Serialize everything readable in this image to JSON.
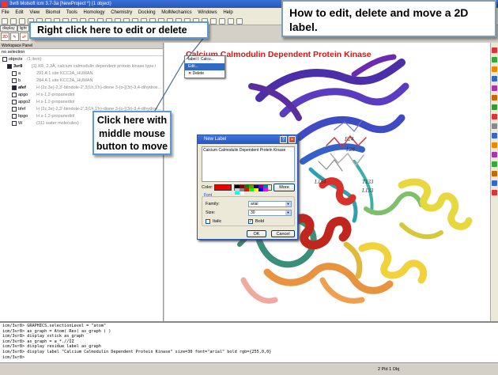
{
  "window": {
    "title": "3vr8 Molsoft icm 3.7-3a  [NewProject *] (1 object)"
  },
  "menu": {
    "items": [
      "File",
      "Edit",
      "View",
      "Biomol",
      "Tools",
      "Homology",
      "Chemistry",
      "Docking",
      "MolMechanics",
      "Windows",
      "Help"
    ]
  },
  "tabs": [
    "display",
    "light"
  ],
  "workspace": {
    "header": "Workspace Panel",
    "selection": "no selection",
    "rows": [
      {
        "name": "objects",
        "desc": "(1 item)",
        "indent": 0,
        "checked": false,
        "bold": false
      },
      {
        "name": "3vr8",
        "desc": "[1] XR, 2.3Å, calcium calmodulin dependent protein kinase type i",
        "indent": 1,
        "checked": true,
        "bold": true
      },
      {
        "name": "a",
        "desc": "291 A  1 site KCC2A_HUMAN",
        "indent": 2,
        "checked": false,
        "bold": false
      },
      {
        "name": "b",
        "desc": "284 A  1 site KCC2A_HUMAN",
        "indent": 2,
        "checked": false,
        "bold": false
      },
      {
        "name": "afef",
        "desc": "H  (2z,3e)-2,3'-biindole-2',3(1h,1'h)-dione 3-{o-[(3r)-3,4-dihydrox...",
        "indent": 2,
        "checked": true,
        "bold": true
      },
      {
        "name": "apgo",
        "desc": "H  s-1,2-propanediol",
        "indent": 2,
        "checked": false,
        "bold": false
      },
      {
        "name": "apgo2",
        "desc": "H  s-1,2-propanediol",
        "indent": 2,
        "checked": false,
        "bold": false
      },
      {
        "name": "bfef",
        "desc": "H  (2z,3e)-2,3'-biindole-2',3(1h,1'h)-dione 3-{o-[(3r)-3,4-dihydrox...",
        "indent": 2,
        "checked": false,
        "bold": false
      },
      {
        "name": "bpgo",
        "desc": "H  s-1,2-propanediol",
        "indent": 2,
        "checked": false,
        "bold": false
      },
      {
        "name": "W",
        "desc": "(311 water molecules)",
        "indent": 2,
        "checked": false,
        "bold": false
      }
    ]
  },
  "label3d": {
    "text": "Calcium Calmodulin Dependent Protein Kinase",
    "color": "#e31010"
  },
  "context_menu": {
    "items": [
      "label l: Calcu...",
      "Edit...",
      "Delete"
    ],
    "highlight": 1
  },
  "dialog": {
    "title": "New Label",
    "text": "Calcium Calmodulin Dependent Protein Kinase",
    "color_label": "Color:",
    "more_label": "More",
    "font_group": "Font",
    "family_label": "Family:",
    "family_value": "arial",
    "size_label": "Size:",
    "size_value": "30",
    "italic_label": "Italic",
    "bold_label": "Bold",
    "bold_checked": true,
    "ok_label": "OK",
    "cancel_label": "Cancel",
    "swatch_color": "#ee0000"
  },
  "residue_labels": [
    "F24",
    "L28",
    "L154",
    "T133",
    "L133"
  ],
  "console": {
    "lines": [
      "icm/3vr8> GRAPHICS.selectionLevel = \"atom\"",
      "icm/3vr8> as_graph = Atom( Res( as_graph ) )",
      "icm/3vr8> display xstick as_graph",
      "icm/3vr8> as_graph = a_*.//IZ",
      "icm/3vr8> display residue label as_graph",
      "icm/3vr8> display label \"Calcium Calmodulin Dependent Protein Kinase\" size=30 font=\"arial\" bold rgb={255,0,0}",
      "icm/3vr8> "
    ]
  },
  "status": {
    "text": "2 Pld 1 Obj"
  },
  "callouts": {
    "top": "How to edit, delete and move a 2D label.",
    "right_click": "Right click here to edit or delete",
    "middle_click": "Click here with middle mouse button to move"
  }
}
